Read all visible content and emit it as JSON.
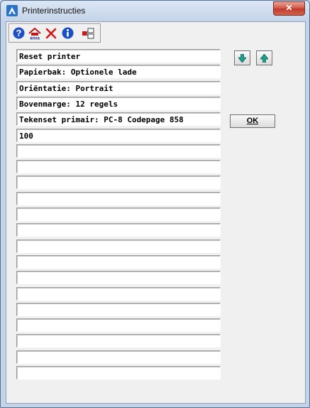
{
  "window": {
    "title": "Printerinstructies",
    "close_label": "✕"
  },
  "toolbar": {
    "buttons": [
      {
        "name": "help-icon"
      },
      {
        "name": "anva-home-icon"
      },
      {
        "name": "delete-icon"
      },
      {
        "name": "info-icon"
      },
      {
        "name": "transfer-icon"
      }
    ]
  },
  "instructions": [
    "Reset printer",
    "Papierbak: Optionele lade",
    "Oriëntatie: Portrait",
    "Bovenmarge: 12 regels",
    "Tekenset primair: PC-8 Codepage 858",
    "100",
    "",
    "",
    "",
    "",
    "",
    "",
    "",
    "",
    "",
    "",
    "",
    "",
    "",
    "",
    ""
  ],
  "buttons": {
    "down_icon": "arrow-down-icon",
    "up_icon": "arrow-up-icon",
    "ok_label": "OK"
  },
  "colors": {
    "arrow": "#1aa38f",
    "help": "#1d4fc4",
    "delete": "#d01818"
  }
}
